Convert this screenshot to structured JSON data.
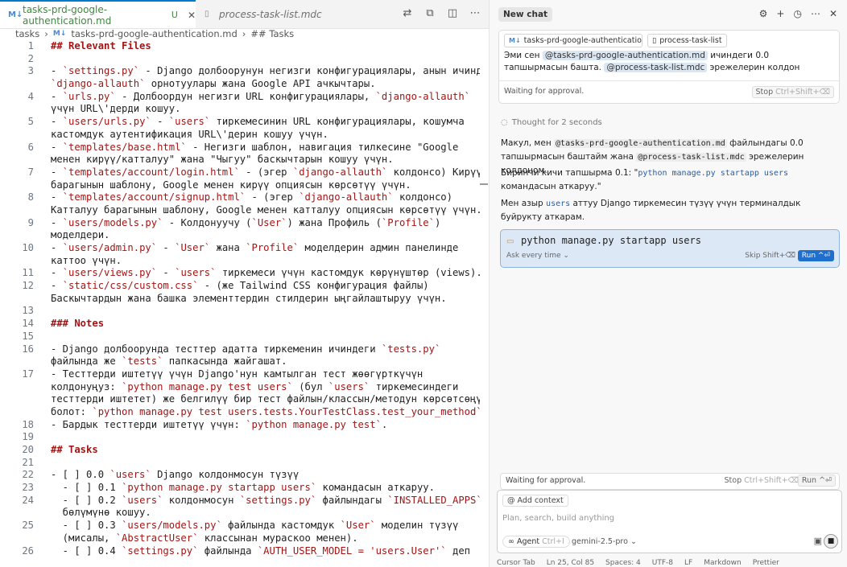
{
  "editor": {
    "tabs": [
      {
        "label": "tasks-prd-google-authentication.md",
        "modified": "U",
        "icon": "markdown-icon"
      },
      {
        "label": "process-task-list.mdc",
        "icon": "file-icon"
      }
    ],
    "breadcrumb": [
      "tasks",
      "tasks-prd-google-authentication.md",
      "## Tasks"
    ],
    "lines": [
      {
        "n": "1",
        "t": "## Relevant Files",
        "k": "h"
      },
      {
        "n": "2",
        "t": ""
      },
      {
        "n": "3",
        "t": "- `settings.py` - Django долбоорунун негизги конфигурациялары, анын ичинде"
      },
      {
        "n": "",
        "t": "`django-allauth` орнотуулары жана Google API ачкычтары."
      },
      {
        "n": "4",
        "t": "- `urls.py` - Долбоордун негизги URL конфигурациялары, `django-allauth`"
      },
      {
        "n": "",
        "t": "үчүн URL\\'дерди кошуу."
      },
      {
        "n": "5",
        "t": "- `users/urls.py` - `users` тиркемесинин URL конфигурациялары, кошумча"
      },
      {
        "n": "",
        "t": "кастомдук аутентификация URL\\'дерин кошуу үчүн."
      },
      {
        "n": "6",
        "t": "- `templates/base.html` - Негизги шаблон, навигация тилкесине \"Google"
      },
      {
        "n": "",
        "t": "менен кирүү/катталуу\" жана \"Чыгуу\" баскычтарын кошуу үчүн."
      },
      {
        "n": "7",
        "t": "- `templates/account/login.html` - (эгер `django-allauth` колдонсо) Кирүү"
      },
      {
        "n": "",
        "t": "барагынын шаблону, Google менен кирүү опциясын көрсөтүү үчүн."
      },
      {
        "n": "8",
        "t": "- `templates/account/signup.html` - (эгер `django-allauth` колдонсо)"
      },
      {
        "n": "",
        "t": "Катталуу барагынын шаблону, Google менен катталуу опциясын көрсөтүү үчүн."
      },
      {
        "n": "9",
        "t": "- `users/models.py` - Колдонуучу (`User`) жана Профиль (`Profile`)"
      },
      {
        "n": "",
        "t": "моделдери."
      },
      {
        "n": "10",
        "t": "- `users/admin.py` - `User` жана `Profile` моделдерин админ панелинде"
      },
      {
        "n": "",
        "t": "каттоо үчүн."
      },
      {
        "n": "11",
        "t": "- `users/views.py` - `users` тиркемеси үчүн кастомдук көрүнүштөр (views)."
      },
      {
        "n": "12",
        "t": "- `static/css/custom.css` - (же Tailwind CSS конфигурация файлы)"
      },
      {
        "n": "",
        "t": "Баскычтардын жана башка элементтердин стилдерин ыңгайлаштыруу үчүн."
      },
      {
        "n": "13",
        "t": ""
      },
      {
        "n": "14",
        "t": "### Notes",
        "k": "h"
      },
      {
        "n": "15",
        "t": ""
      },
      {
        "n": "16",
        "t": "- Django долбоорунда тесттер адатта тиркеменин ичиндеги `tests.py`"
      },
      {
        "n": "",
        "t": "файлында же `tests` папкасында жайгашат."
      },
      {
        "n": "17",
        "t": "- Тесттерди иштетүү үчүн Django'нун камтылган тест жөөгүрткүчүн"
      },
      {
        "n": "",
        "t": "колдонуңуз: `python manage.py test users` (бул `users` тиркемесиндеги"
      },
      {
        "n": "",
        "t": "тесттерди иштетет) же белгилүү бир тест файлын/классын/методун көрсөтсөңүз"
      },
      {
        "n": "",
        "t": "болот: `python manage.py test users.tests.YourTestClass.test_your_method`."
      },
      {
        "n": "18",
        "t": "- Бардык тесттерди иштетүү үчүн: `python manage.py test`."
      },
      {
        "n": "19",
        "t": ""
      },
      {
        "n": "20",
        "t": "## Tasks",
        "k": "h"
      },
      {
        "n": "21",
        "t": ""
      },
      {
        "n": "22",
        "t": "- [ ] 0.0 `users` Django колдонмосун түзүү"
      },
      {
        "n": "23",
        "t": "  - [ ] 0.1 `python manage.py startapp users` командасын аткаруу."
      },
      {
        "n": "24",
        "t": "  - [ ] 0.2 `users` колдонмосун `settings.py` файлындагы `INSTALLED_APPS`"
      },
      {
        "n": "",
        "t": "  бөлүмүнө кошуу."
      },
      {
        "n": "25",
        "t": "  - [ ] 0.3 `users/models.py` файлында кастомдук `User` моделин түзүү"
      },
      {
        "n": "",
        "t": "  (мисалы, `AbstractUser` классынан мураскоо менен)."
      },
      {
        "n": "26",
        "t": "  - [ ] 0.4 `settings.py` файлында `AUTH_USER_MODEL = 'users.User'` деп"
      }
    ]
  },
  "status": {
    "items": [
      "Cursor Tab",
      "Ln 25, Col 85",
      "Spaces: 4",
      "UTF-8",
      "LF",
      "Markdown",
      "Prettier"
    ]
  },
  "chat": {
    "new_chat": "New chat",
    "context_chips": [
      "tasks-prd-google-authenticatio...",
      "process-task-list"
    ],
    "user_msg": {
      "pre": "Эми сен",
      "ref1": "@tasks-prd-google-authentication.md",
      "mid": "ичиндеги 0.0 тапшырмасын башта.",
      "ref2": "@process-task-list.mdc",
      "post": "эрежелерин колдон"
    },
    "waiting": "Waiting for approval.",
    "stop": "Stop",
    "stop_kbd": "Ctrl+Shift+⌫",
    "thought": "Thought for 2 seconds",
    "reply1": {
      "a": "Макул, мен",
      "ref1": "@tasks-prd-google-authentication.md",
      "b": "файлындагы 0.0 тапшырмасын баштайм жана",
      "ref2": "@process-task-list.mdc",
      "c": "эрежелерин колдоном."
    },
    "reply2": {
      "a": "Биринчи кичи тапшырма 0.1: \"",
      "code": "python manage.py startapp users",
      "b": "командасын аткаруу.\""
    },
    "reply3": {
      "a": "Мен азыр",
      "code": "users",
      "b": "аттуу Django тиркемесин түзүү үчүн терминалдык буйрукту аткарам."
    },
    "command": "python manage.py startapp users",
    "ask_every_time": "Ask every time",
    "skip": "Skip Shift+⌫",
    "run": "Run ^⏎",
    "bottom_run": "Run ^⏎",
    "add_context": "Add context",
    "placeholder": "Plan, search, build anything",
    "agent": "Agent",
    "agent_kbd": "Ctrl+I",
    "model": "gemini-2.5-pro"
  }
}
